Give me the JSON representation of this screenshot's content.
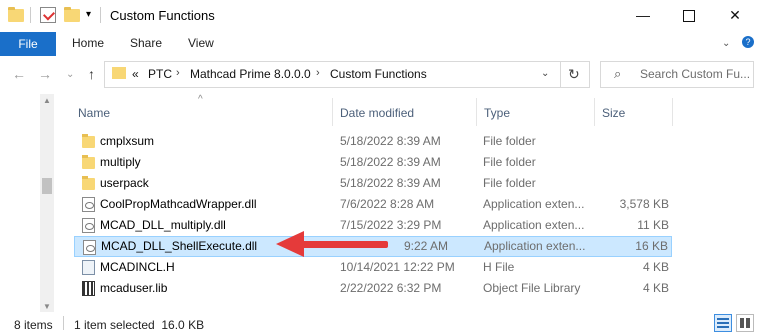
{
  "window": {
    "title": "Custom Functions",
    "controls": [
      "minimize-icon",
      "maximize-icon",
      "close-icon"
    ]
  },
  "ribbon": {
    "file_label": "File",
    "tabs": [
      "Home",
      "Share",
      "View"
    ]
  },
  "address": {
    "overflow": "«",
    "crumbs": [
      "PTC",
      "Mathcad Prime 8.0.0.0",
      "Custom Functions"
    ],
    "search_placeholder": "Search Custom Fu..."
  },
  "columns": {
    "name": "Name",
    "date": "Date modified",
    "type": "Type",
    "size": "Size"
  },
  "files": [
    {
      "name": "cmplxsum",
      "date": "5/18/2022 8:39 AM",
      "type": "File folder",
      "size": "",
      "icon": "folder-icon"
    },
    {
      "name": "multiply",
      "date": "5/18/2022 8:39 AM",
      "type": "File folder",
      "size": "",
      "icon": "folder-icon"
    },
    {
      "name": "userpack",
      "date": "5/18/2022 8:39 AM",
      "type": "File folder",
      "size": "",
      "icon": "folder-icon"
    },
    {
      "name": "CoolPropMathcadWrapper.dll",
      "date": "7/6/2022 8:28 AM",
      "type": "Application exten...",
      "size": "3,578 KB",
      "icon": "dll-icon"
    },
    {
      "name": "MCAD_DLL_multiply.dll",
      "date": "7/15/2022 3:29 PM",
      "type": "Application exten...",
      "size": "11 KB",
      "icon": "dll-icon"
    },
    {
      "name": "MCAD_DLL_ShellExecute.dll",
      "date": "9:22 AM",
      "type": "Application exten...",
      "size": "16 KB",
      "icon": "dll-icon",
      "selected": true
    },
    {
      "name": "MCADINCL.H",
      "date": "10/14/2021 12:22 PM",
      "type": "H File",
      "size": "4 KB",
      "icon": "header-file-icon"
    },
    {
      "name": "mcaduser.lib",
      "date": "2/22/2022 6:32 PM",
      "type": "Object File Library",
      "size": "4 KB",
      "icon": "library-file-icon"
    }
  ],
  "status": {
    "count": "8 items",
    "selection": "1 item selected  16.0 KB"
  },
  "colors": {
    "file_tab": "#1a6fc9",
    "selection": "#cce8ff",
    "arrow": "#e53a3a"
  }
}
